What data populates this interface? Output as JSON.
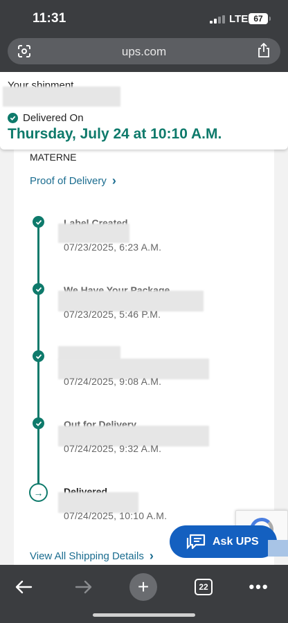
{
  "status_bar": {
    "time": "11:31",
    "network": "LTE",
    "battery": "67"
  },
  "browser": {
    "url": "ups.com",
    "open_tabs": "22"
  },
  "header": {
    "shipment_label": "Your shipment",
    "delivered_on_label": "Delivered On",
    "delivery_date": "Thursday, July 24 at 10:10 A.M."
  },
  "details": {
    "recipient_name": "MATERNE",
    "proof_of_delivery_link": "Proof of Delivery",
    "view_all_link": "View All Shipping Details"
  },
  "timeline": [
    {
      "title": "Label Created",
      "time": "07/23/2025, 6:23 A.M.",
      "status": "complete"
    },
    {
      "title": "We Have Your Package",
      "time": "07/23/2025, 5:46 P.M.",
      "status": "complete"
    },
    {
      "title": "",
      "time": "07/24/2025, 9:08 A.M.",
      "status": "complete"
    },
    {
      "title": "Out for Delivery",
      "time": "07/24/2025, 9:32 A.M.",
      "status": "complete"
    },
    {
      "title": "Delivered",
      "time": "07/24/2025, 10:10 A.M.",
      "status": "current"
    }
  ],
  "assistant": {
    "label": "Ask UPS"
  },
  "colors": {
    "accent_green": "#0e7a6b",
    "link_blue": "#1a6c8f",
    "chat_blue": "#1460c0",
    "chrome_dark": "#3b3d40"
  },
  "icons": {
    "lens": "google-lens-icon",
    "share": "share-icon",
    "back": "back-arrow-icon",
    "forward": "forward-arrow-icon",
    "new_tab": "plus-icon",
    "tabs": "tabs-icon",
    "more": "more-icon",
    "chat": "chat-icon"
  }
}
